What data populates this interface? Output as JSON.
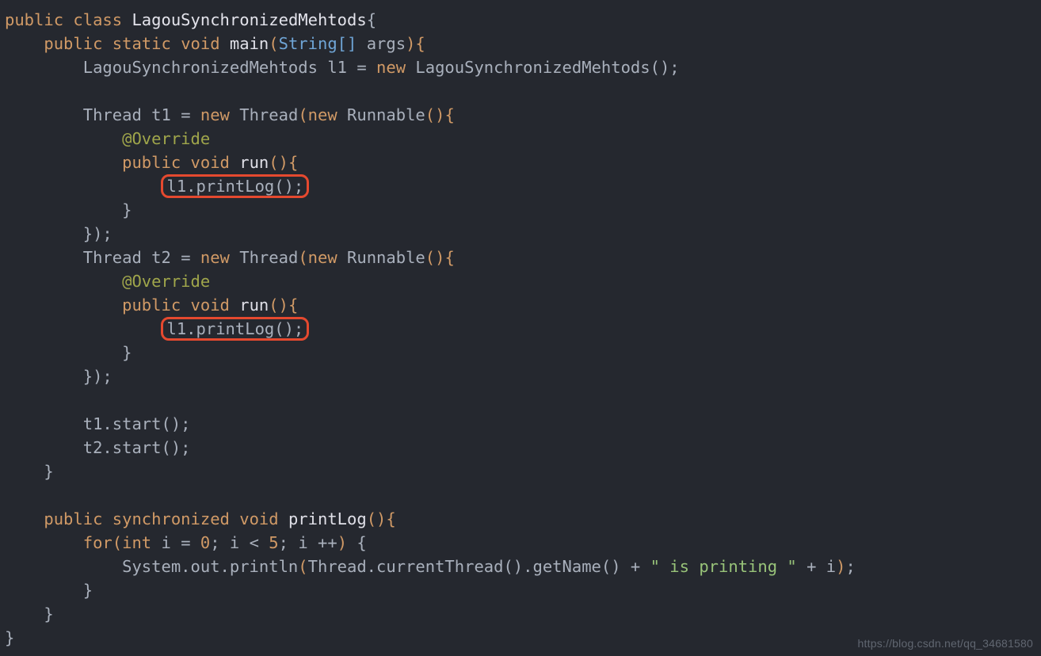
{
  "code": {
    "kw_public": "public",
    "kw_class": "class",
    "class_name": "LagouSynchronizedMehtods",
    "kw_static": "static",
    "kw_void": "void",
    "main": "main",
    "type_string_arr": "String[]",
    "param_args": "args",
    "local_type": "LagouSynchronizedMehtods",
    "l1": "l1",
    "kw_new": "new",
    "ctor": "LagouSynchronizedMehtods",
    "thread_type": "Thread",
    "t1": "t1",
    "t2": "t2",
    "runnable": "Runnable",
    "ann_override": "@Override",
    "run": "run",
    "call_printlog": "l1.printLog();",
    "start1": "t1.start();",
    "start2": "t2.start();",
    "kw_synchronized": "synchronized",
    "printLog": "printLog",
    "kw_for": "for",
    "kw_int": "int",
    "i": "i",
    "zero": "0",
    "lt": "<",
    "five": "5",
    "ipp": "i ++",
    "sysout": "System.out.println",
    "thread_call": "Thread.currentThread().getName()",
    "plus": "+",
    "str_ispr": "\" is printing \"",
    "lbrace": "{",
    "rbrace": "}",
    "lparen": "(",
    "rparen": ")",
    "rparen_brace": "){",
    "rparen_semi": "();",
    "rbrace_paren_semi": "});",
    "semi": ";",
    "eq": "="
  },
  "watermark": "https://blog.csdn.net/qq_34681580"
}
